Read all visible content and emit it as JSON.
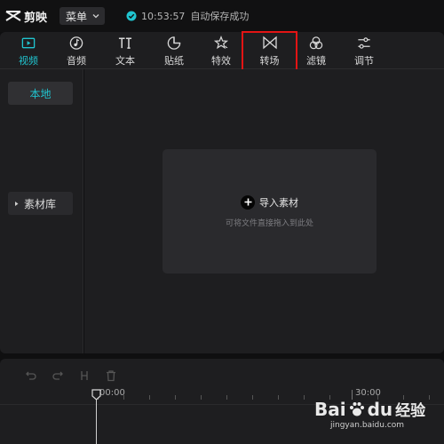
{
  "app": {
    "name": "剪映"
  },
  "menu": {
    "label": "菜单"
  },
  "status": {
    "time": "10:53:57",
    "text": "自动保存成功"
  },
  "toolbar": {
    "tools": [
      {
        "label": "视频",
        "icon": "video-icon",
        "active": true
      },
      {
        "label": "音频",
        "icon": "audio-icon",
        "active": false
      },
      {
        "label": "文本",
        "icon": "text-icon",
        "active": false
      },
      {
        "label": "贴纸",
        "icon": "sticker-icon",
        "active": false
      },
      {
        "label": "特效",
        "icon": "effects-icon",
        "active": false
      },
      {
        "label": "转场",
        "icon": "transition-icon",
        "active": false,
        "highlighted": true
      },
      {
        "label": "滤镜",
        "icon": "filter-icon",
        "active": false
      },
      {
        "label": "调节",
        "icon": "adjust-icon",
        "active": false
      }
    ]
  },
  "sidebar": {
    "local_label": "本地",
    "library_label": "素材库"
  },
  "dropzone": {
    "import_label": "导入素材",
    "hint": "可将文件直接拖入到此处"
  },
  "timeline": {
    "tools": [
      "undo-icon",
      "redo-icon",
      "split-icon",
      "delete-icon"
    ],
    "time_start": "00:00",
    "time_mid": "30:00"
  },
  "watermark": {
    "brand_a": "Bai",
    "brand_b": "du",
    "brand_c": "经验",
    "url": "jingyan.baidu.com"
  },
  "colors": {
    "accent": "#20c4cf",
    "highlight_box": "#e31414",
    "panel": "#1e1e20",
    "background": "#0f0f10"
  }
}
